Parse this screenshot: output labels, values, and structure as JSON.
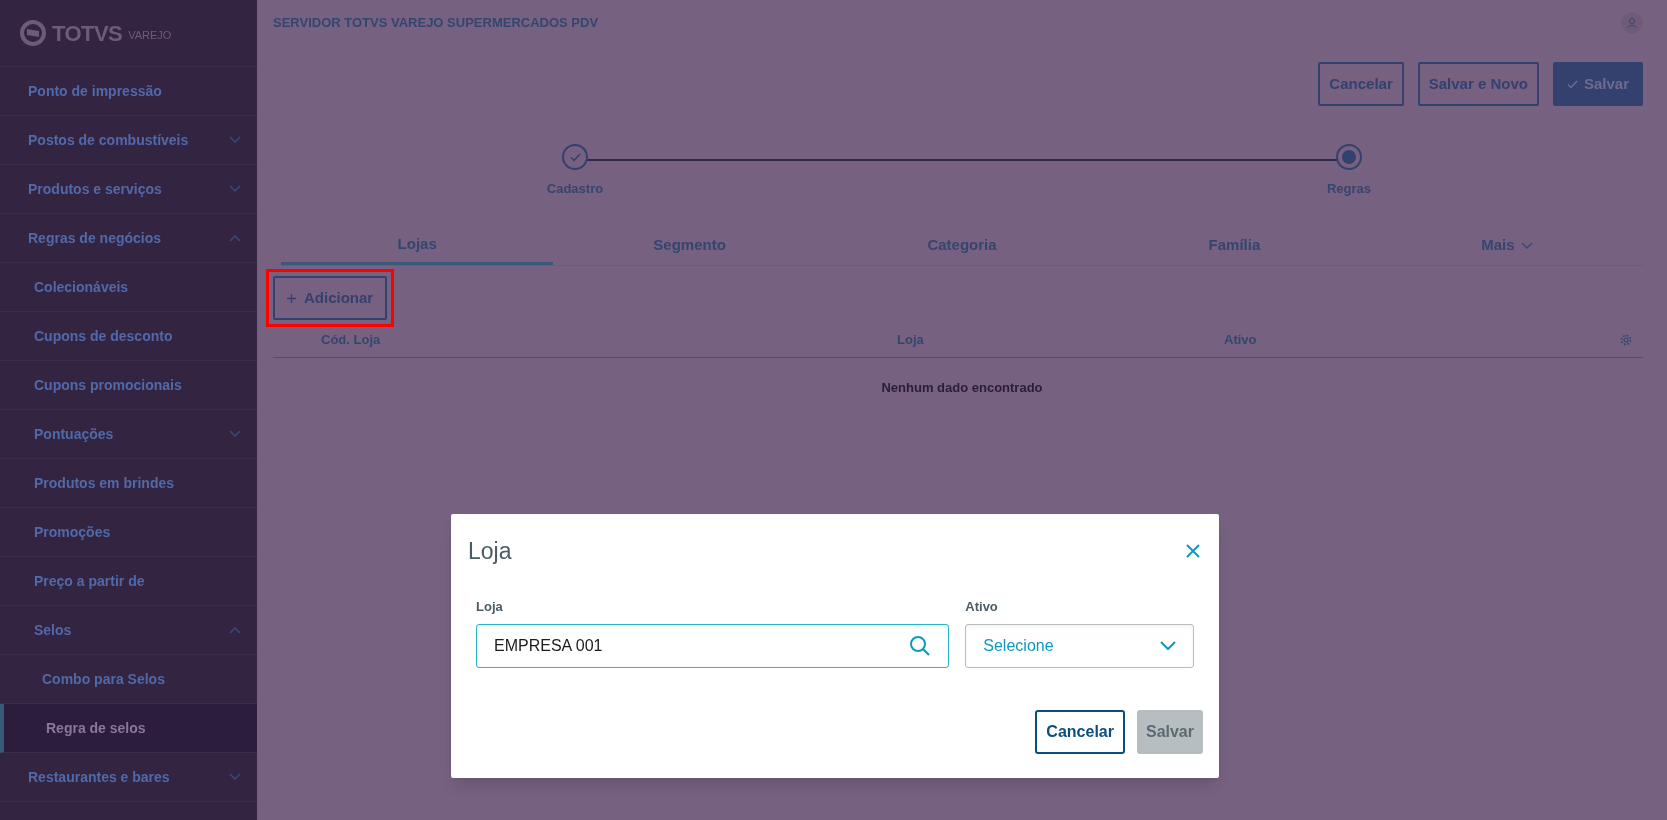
{
  "sidebar": {
    "logo": {
      "brand": "TOTVS",
      "product": "VAREJO"
    },
    "items": [
      {
        "label": "Ponto de impressão",
        "kind": "link",
        "selected": false
      },
      {
        "label": "Postos de combustíveis",
        "kind": "group",
        "expanded": false,
        "selected": false
      },
      {
        "label": "Produtos e serviços",
        "kind": "group",
        "expanded": false,
        "selected": false
      },
      {
        "label": "Regras de negócios",
        "kind": "group",
        "expanded": true,
        "selected": false,
        "children": [
          {
            "label": "Colecionáveis",
            "kind": "link",
            "selected": false
          },
          {
            "label": "Cupons de desconto",
            "kind": "link",
            "selected": false
          },
          {
            "label": "Cupons promocionais",
            "kind": "link",
            "selected": false
          },
          {
            "label": "Pontuações",
            "kind": "group",
            "expanded": false,
            "selected": false
          },
          {
            "label": "Produtos em brindes",
            "kind": "link",
            "selected": false
          },
          {
            "label": "Promoções",
            "kind": "link",
            "selected": false
          },
          {
            "label": "Preço a partir de",
            "kind": "link",
            "selected": false
          },
          {
            "label": "Selos",
            "kind": "group",
            "expanded": true,
            "selected": false,
            "children": [
              {
                "label": "Combo para Selos",
                "kind": "link",
                "selected": false
              },
              {
                "label": "Regra de selos",
                "kind": "link",
                "selected": true
              }
            ]
          }
        ]
      },
      {
        "label": "Restaurantes e bares",
        "kind": "group",
        "expanded": false,
        "selected": false
      }
    ]
  },
  "header": {
    "title": "SERVIDOR TOTVS VAREJO SUPERMERCADOS PDV"
  },
  "actions": [
    {
      "label": "Cancelar",
      "kind": "secondary"
    },
    {
      "label": "Salvar e Novo",
      "kind": "secondary"
    },
    {
      "label": "Salvar",
      "kind": "primary"
    }
  ],
  "stepper": [
    {
      "label": "Cadastro",
      "completed": true,
      "selected": false
    },
    {
      "label": "Regras",
      "completed": false,
      "selected": true
    }
  ],
  "tabs": [
    {
      "label": "Lojas",
      "selected": true
    },
    {
      "label": "Segmento",
      "selected": false
    },
    {
      "label": "Categoria",
      "selected": false
    },
    {
      "label": "Família",
      "selected": false
    },
    {
      "label": "Mais",
      "selected": false
    }
  ],
  "add_button": {
    "label": "Adicionar",
    "highlighted": true
  },
  "table": {
    "columns": [
      "Cód. Loja",
      "Loja",
      "Ativo"
    ],
    "empty_message": "Nenhum dado encontrado"
  },
  "dialog": {
    "title": "Loja",
    "fields": [
      {
        "label": "Loja",
        "kind": "search",
        "value": "EMPRESA 001"
      },
      {
        "label": "Ativo",
        "kind": "select",
        "placeholder": "Selecione"
      }
    ],
    "buttons": [
      {
        "label": "Cancelar",
        "disabled": false
      },
      {
        "label": "Salvar",
        "disabled": true
      }
    ]
  }
}
